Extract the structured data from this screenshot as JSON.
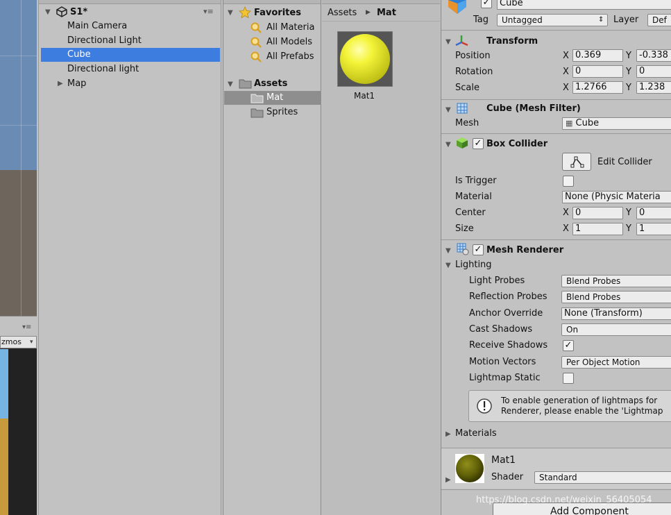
{
  "hierarchy": {
    "scene_name": "S1*",
    "items": [
      {
        "label": "Main Camera"
      },
      {
        "label": "Directional Light"
      },
      {
        "label": "Cube"
      },
      {
        "label": "Directional light"
      },
      {
        "label": "Map"
      }
    ]
  },
  "scene": {
    "gizmos_label": "zmos"
  },
  "project": {
    "favorites_label": "Favorites",
    "favorites": [
      "All Materia",
      "All Models",
      "All Prefabs"
    ],
    "assets_label": "Assets",
    "folders": [
      "Mat",
      "Sprites"
    ],
    "breadcrumb": [
      "Assets",
      "Mat"
    ],
    "asset_name": "Mat1"
  },
  "inspector": {
    "object_name": "Cube",
    "tag_label": "Tag",
    "tag_value": "Untagged",
    "layer_label": "Layer",
    "layer_value": "Def",
    "transform": {
      "title": "Transform",
      "position_label": "Position",
      "rotation_label": "Rotation",
      "scale_label": "Scale",
      "position": {
        "x": "0.369",
        "y": "-0.338"
      },
      "rotation": {
        "x": "0",
        "y": "0"
      },
      "scale": {
        "x": "1.2766",
        "y": "1.238"
      }
    },
    "mesh_filter": {
      "title": "Cube (Mesh Filter)",
      "mesh_label": "Mesh",
      "mesh_value": "Cube"
    },
    "box_collider": {
      "title": "Box Collider",
      "edit_label": "Edit Collider",
      "is_trigger_label": "Is Trigger",
      "material_label": "Material",
      "material_value": "None (Physic Materia",
      "center_label": "Center",
      "center": {
        "x": "0",
        "y": "0"
      },
      "size_label": "Size",
      "size": {
        "x": "1",
        "y": "1"
      }
    },
    "mesh_renderer": {
      "title": "Mesh Renderer",
      "lighting_label": "Lighting",
      "light_probes_label": "Light Probes",
      "light_probes_value": "Blend Probes",
      "reflection_probes_label": "Reflection Probes",
      "reflection_probes_value": "Blend Probes",
      "anchor_override_label": "Anchor Override",
      "anchor_override_value": "None (Transform)",
      "cast_shadows_label": "Cast Shadows",
      "cast_shadows_value": "On",
      "receive_shadows_label": "Receive Shadows",
      "motion_vectors_label": "Motion Vectors",
      "motion_vectors_value": "Per Object Motion",
      "lightmap_static_label": "Lightmap Static",
      "help_line1": "To enable generation of lightmaps for",
      "help_line2": "Renderer, please enable the 'Lightmap",
      "materials_label": "Materials"
    },
    "material": {
      "name": "Mat1",
      "shader_label": "Shader",
      "shader_value": "Standard"
    },
    "add_component_label": "Add Component",
    "axis_x": "X",
    "axis_y": "Y"
  },
  "watermark": "https://blog.csdn.net/weixin_56405054",
  "colors": {
    "panel_bg": "#c2c2c2",
    "selection_blue": "#3e7de0",
    "material_yellow": "#f0f040",
    "material_olive": "#6b6b10"
  }
}
